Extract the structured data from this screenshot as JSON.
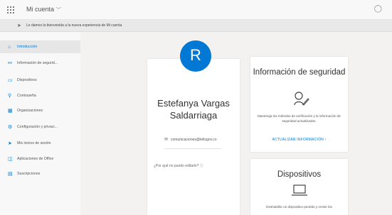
{
  "header": {
    "app_title": "Mi cuenta",
    "chevron": "﹀"
  },
  "banner": {
    "text": "Le damos la bienvenida a la nueva experiencia de Mi cuenta"
  },
  "sidebar": {
    "items": [
      {
        "label": "Introducción",
        "icon": "home-icon",
        "active": true
      },
      {
        "label": "Información de segurid...",
        "icon": "security-info-icon"
      },
      {
        "label": "Dispositivos",
        "icon": "devices-icon"
      },
      {
        "label": "Contraseña",
        "icon": "password-key-icon"
      },
      {
        "label": "Organizaciones",
        "icon": "organizations-icon"
      },
      {
        "label": "Configuración y privaci...",
        "icon": "settings-privacy-icon"
      },
      {
        "label": "Mis inicios de sesión",
        "icon": "sign-ins-icon"
      },
      {
        "label": "Aplicaciones de Office",
        "icon": "office-apps-icon"
      },
      {
        "label": "Suscripciones",
        "icon": "subscriptions-icon"
      }
    ]
  },
  "profile": {
    "avatar_letter": "R",
    "name": "Estefanya Vargas Saldarriaga",
    "email": "comunicaciones@tellugov.co",
    "question": "¿Por qué no puedo editarlo?"
  },
  "security_card": {
    "title": "Información de seguridad",
    "description": "Mantenga los métodos de verificación y la información de seguridad actualizados.",
    "link": "ACTUALIZAR INFORMACIÓN"
  },
  "devices_card": {
    "title": "Dispositivos",
    "description": "Deshabilite un dispositivo perdido y revise los"
  },
  "colors": {
    "accent": "#0078d4",
    "sidebar_bg": "#f8f8f8",
    "page_bg": "#f3f2f1"
  }
}
